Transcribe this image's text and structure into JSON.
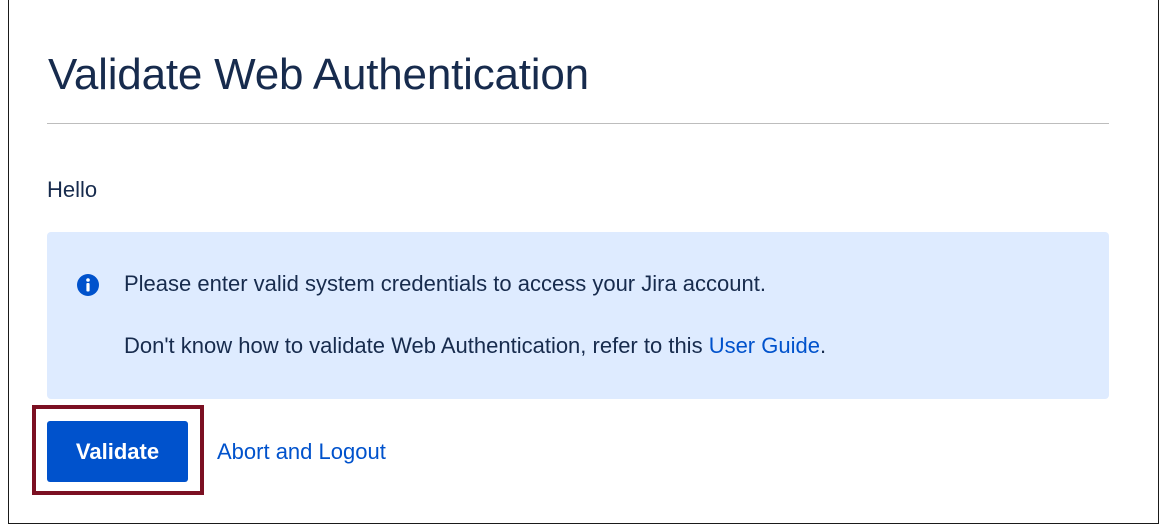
{
  "page": {
    "title": "Validate Web Authentication",
    "greeting": "Hello"
  },
  "info_panel": {
    "icon": "info-icon",
    "message_line1": "Please enter valid system credentials to access your Jira account.",
    "message_line2_prefix": "Don't know how to validate Web Authentication, refer to this ",
    "guide_link_label": "User Guide",
    "message_line2_suffix": ".",
    "background_color": "#deebff"
  },
  "actions": {
    "validate_label": "Validate",
    "abort_label": "Abort and Logout"
  },
  "colors": {
    "primary": "#0052cc",
    "text": "#172b4d",
    "highlight": "#7b1022"
  }
}
